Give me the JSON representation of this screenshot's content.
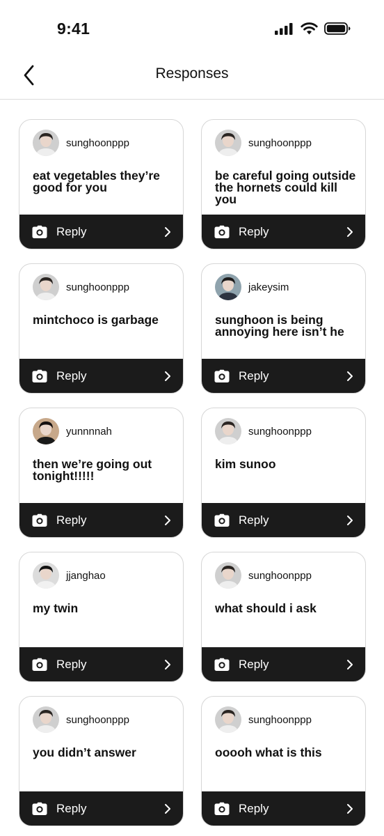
{
  "status_bar": {
    "time": "9:41"
  },
  "nav": {
    "title": "Responses"
  },
  "cards": [
    {
      "username": "sunghoonppp",
      "message": "eat vegetables they’re good for you",
      "avatar": "avatar-photo",
      "reply_label": "Reply"
    },
    {
      "username": "sunghoonppp",
      "message": "be careful going outside the hornets could kill you",
      "avatar": "avatar-photo",
      "reply_label": "Reply"
    },
    {
      "username": "sunghoonppp",
      "message": "mintchoco is garbage",
      "avatar": "avatar-photo",
      "reply_label": "Reply"
    },
    {
      "username": "jakeysim",
      "message": "sunghoon is being annoying here isn’t he",
      "avatar": "avatar-photo",
      "reply_label": "Reply"
    },
    {
      "username": "yunnnnah",
      "message": "then we’re going out tonight!!!!!",
      "avatar": "avatar-photo",
      "reply_label": "Reply"
    },
    {
      "username": "sunghoonppp",
      "message": "kim sunoo",
      "avatar": "avatar-photo",
      "reply_label": "Reply"
    },
    {
      "username": "jjanghao",
      "message": "my twin",
      "avatar": "avatar-photo",
      "reply_label": "Reply"
    },
    {
      "username": "sunghoonppp",
      "message": "what should i ask",
      "avatar": "avatar-photo",
      "reply_label": "Reply"
    },
    {
      "username": "sunghoonppp",
      "message": "you didn’t answer",
      "avatar": "avatar-photo",
      "reply_label": "Reply"
    },
    {
      "username": "sunghoonppp",
      "message": "ooooh what is this",
      "avatar": "avatar-photo",
      "reply_label": "Reply"
    }
  ],
  "icons": {
    "back": "chevron-left-icon",
    "camera": "camera-icon",
    "reply_chevron": "chevron-right-icon",
    "signal": "cellular-signal-icon",
    "wifi": "wifi-icon",
    "battery": "battery-icon"
  },
  "colors": {
    "reply_bar": "#1b1b1b",
    "card_border": "#d6d6d6",
    "background": "#ffffff",
    "text": "#111111"
  }
}
